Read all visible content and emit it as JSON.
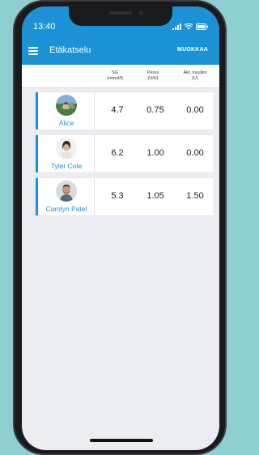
{
  "status_bar": {
    "time": "13:40"
  },
  "toolbar": {
    "title": "Etäkatselu",
    "edit_label": "MUOKKAA"
  },
  "columns": {
    "sg": {
      "title": "SG",
      "unit": "(mmol/l)"
    },
    "basal": {
      "title": "Perus",
      "unit": "(U/H)"
    },
    "active_insulin": {
      "title": "Akt. insuliini",
      "unit": "(U)"
    }
  },
  "patients": [
    {
      "name": "Alice",
      "sg": "4.7",
      "basal": "0.75",
      "active_insulin": "0.00"
    },
    {
      "name": "Tyler Cole",
      "sg": "6.2",
      "basal": "1.00",
      "active_insulin": "0.00"
    },
    {
      "name": "Carolyn Patel",
      "sg": "5.3",
      "basal": "1.05",
      "active_insulin": "1.50"
    }
  ],
  "colors": {
    "accent": "#1b92d6",
    "background": "#ecedf2",
    "page_background": "#8ecfd2"
  },
  "icons": [
    "menu-icon",
    "signal-icon",
    "wifi-icon",
    "battery-icon"
  ]
}
